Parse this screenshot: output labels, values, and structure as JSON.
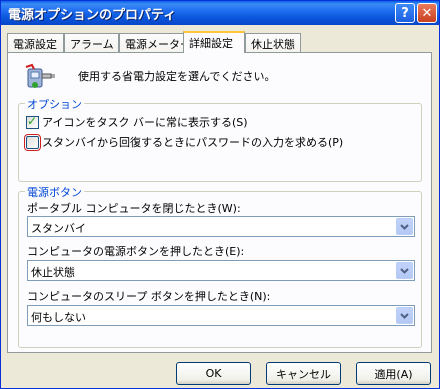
{
  "window": {
    "title": "電源オプションのプロパティ",
    "help_label": "?",
    "close_label": "✕"
  },
  "tabs": [
    {
      "label": "電源設定"
    },
    {
      "label": "アラーム"
    },
    {
      "label": "電源メーター"
    },
    {
      "label": "詳細設定"
    },
    {
      "label": "休止状態"
    }
  ],
  "header": {
    "text": "使用する省電力設定を選んでください。",
    "icon": "power-meter-icon"
  },
  "options_group": {
    "label": "オプション",
    "show_icon": {
      "label": "アイコンをタスク バーに常に表示する(S)",
      "checked": true
    },
    "prompt_password": {
      "label": "スタンバイから回復するときにパスワードの入力を求める(P)",
      "checked": false
    }
  },
  "power_buttons_group": {
    "label": "電源ボタン",
    "lid_close": {
      "label": "ポータブル コンピュータを閉じたとき(W):",
      "value": "スタンバイ"
    },
    "power_button": {
      "label": "コンピュータの電源ボタンを押したとき(E):",
      "value": "休止状態"
    },
    "sleep_button": {
      "label": "コンピュータのスリープ ボタンを押したとき(N):",
      "value": "何もしない"
    }
  },
  "buttons": {
    "ok": "OK",
    "cancel": "キャンセル",
    "apply": "適用(A)"
  },
  "colors": {
    "title_bar": "#0a56dc",
    "group_label": "#0046d5",
    "tab_highlight": "#ffc83c",
    "check_mark": "#21a121"
  }
}
